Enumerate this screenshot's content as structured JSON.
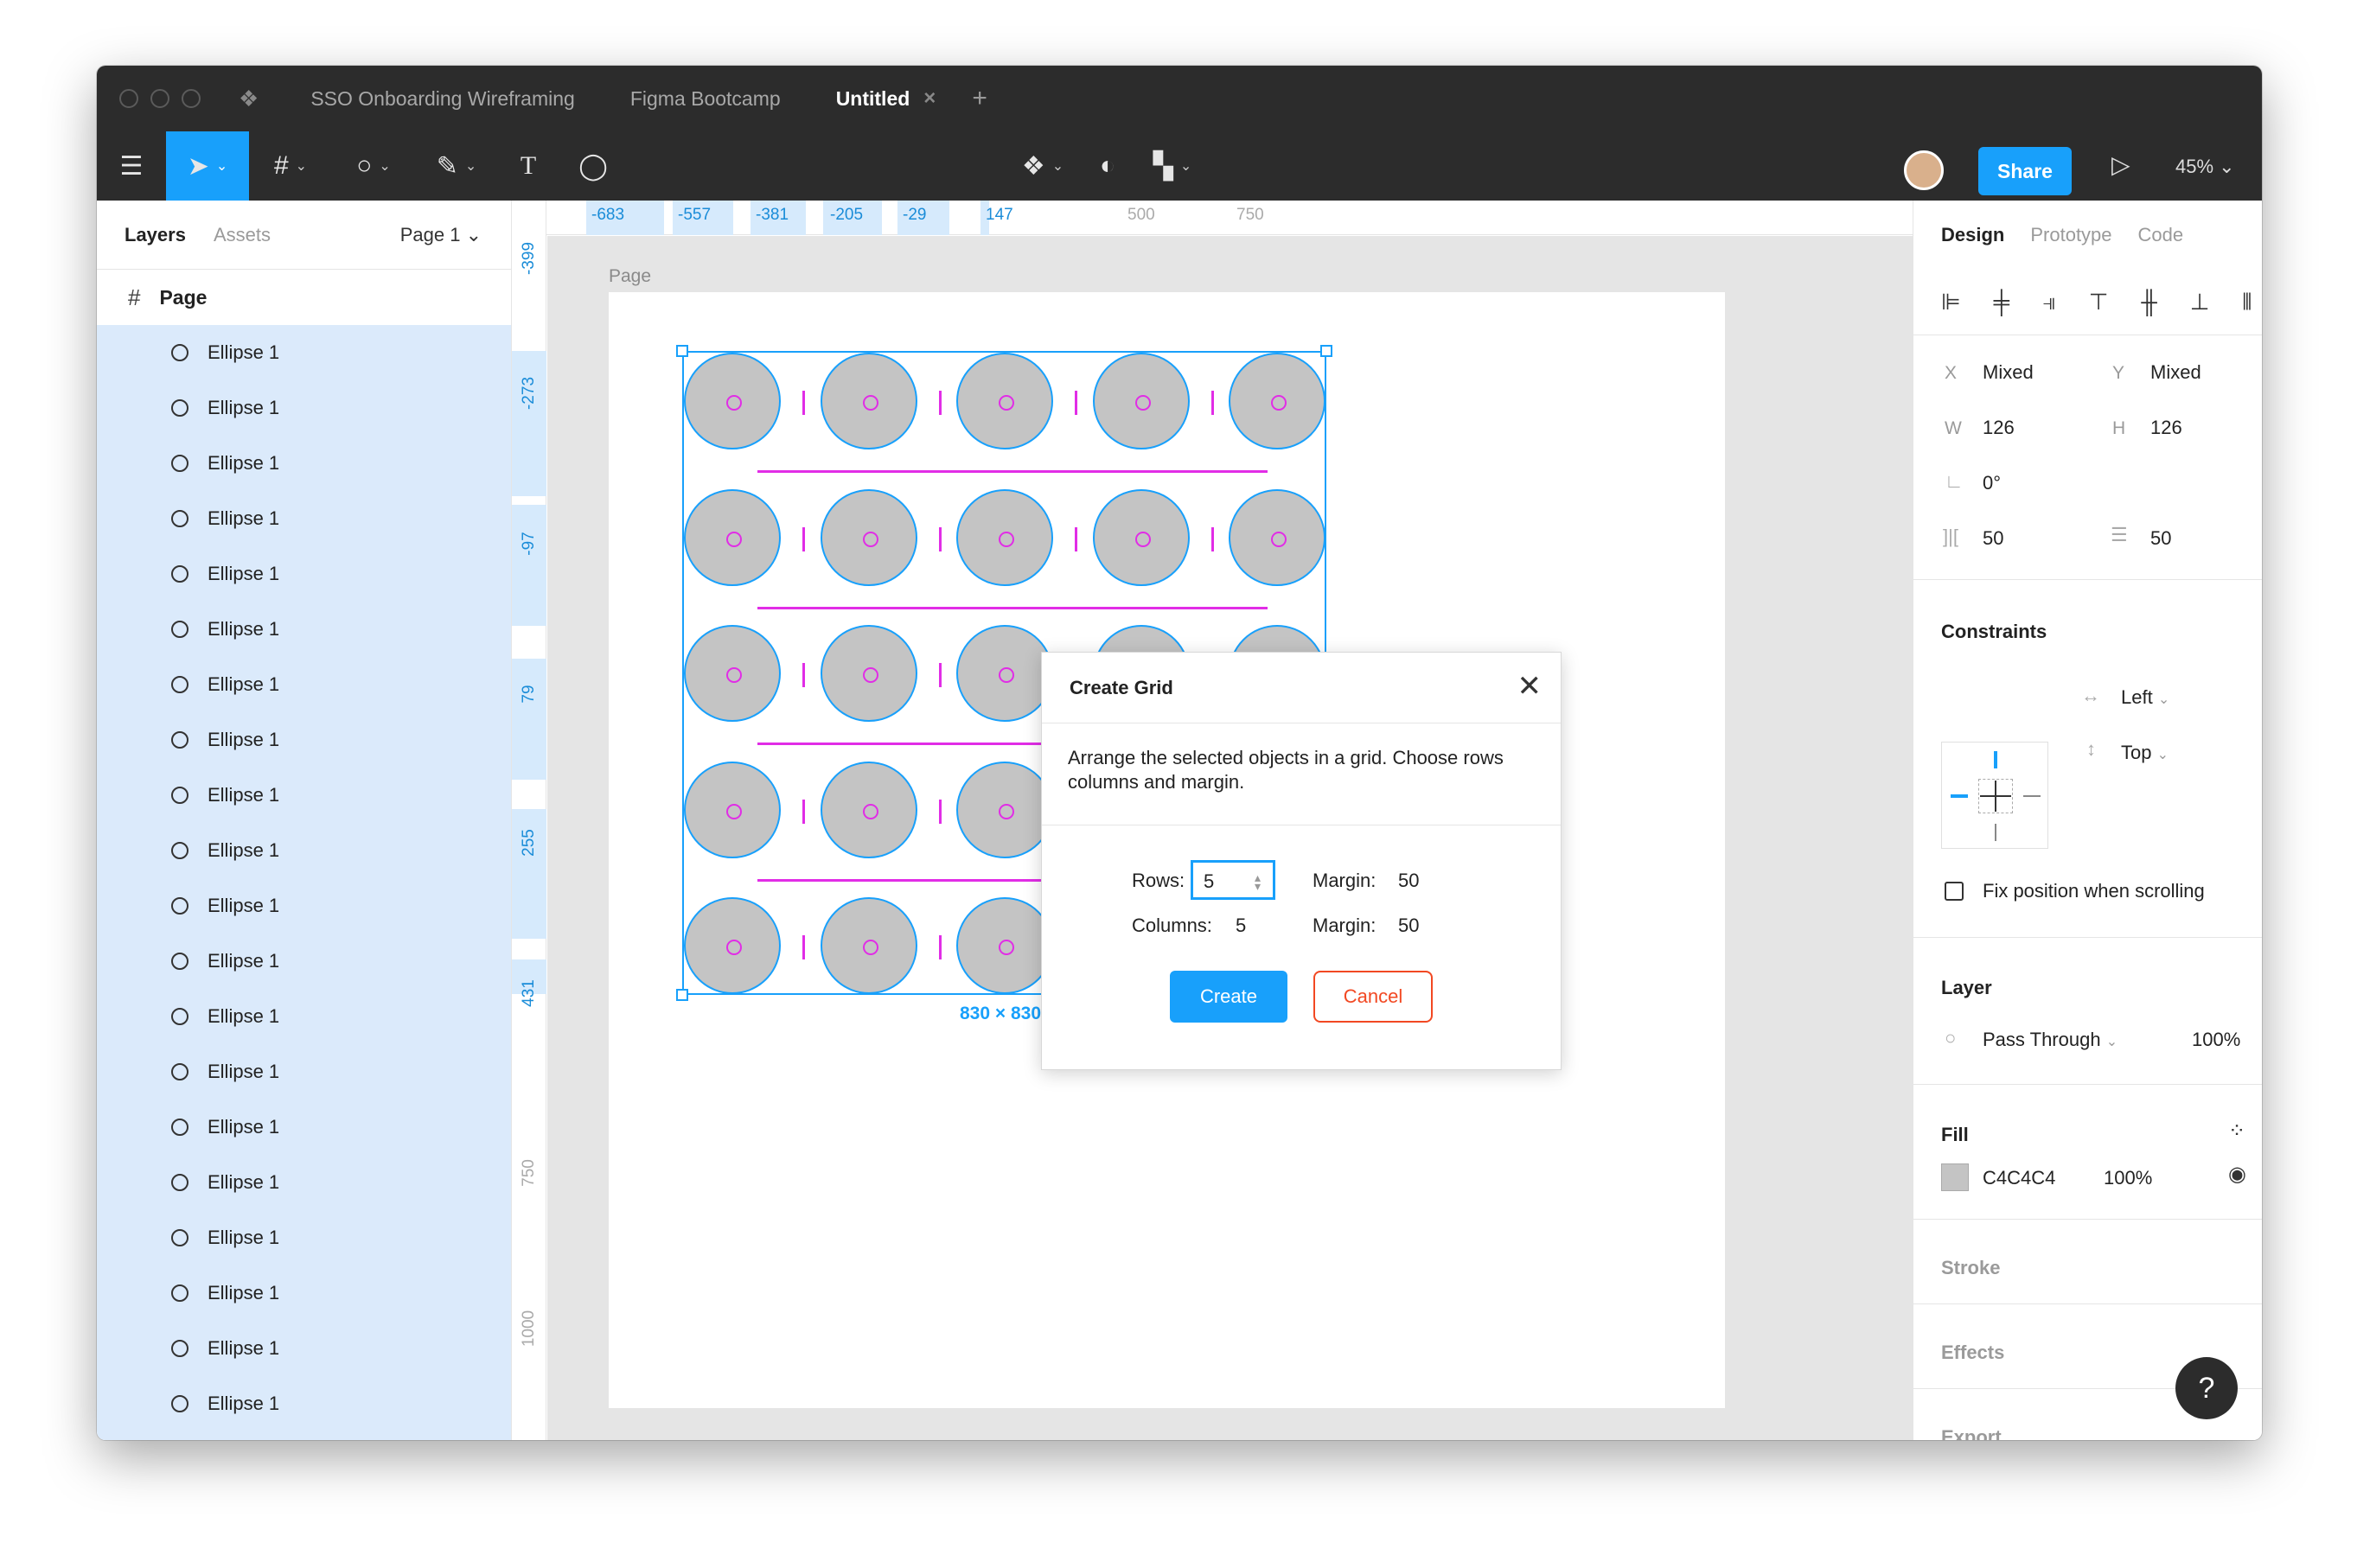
{
  "tabs": [
    {
      "label": "SSO Onboarding Wireframing"
    },
    {
      "label": "Figma Bootcamp"
    },
    {
      "label": "Untitled"
    }
  ],
  "toolbar": {
    "share_label": "Share",
    "zoom": "45%"
  },
  "left_panel": {
    "tab_layers": "Layers",
    "tab_assets": "Assets",
    "page_select": "Page 1",
    "page_name": "Page",
    "layers": [
      "Ellipse 1",
      "Ellipse 1",
      "Ellipse 1",
      "Ellipse 1",
      "Ellipse 1",
      "Ellipse 1",
      "Ellipse 1",
      "Ellipse 1",
      "Ellipse 1",
      "Ellipse 1",
      "Ellipse 1",
      "Ellipse 1",
      "Ellipse 1",
      "Ellipse 1",
      "Ellipse 1",
      "Ellipse 1",
      "Ellipse 1",
      "Ellipse 1",
      "Ellipse 1",
      "Ellipse 1"
    ]
  },
  "rulers": {
    "top": [
      "-683",
      "-557",
      "-381",
      "-205",
      "-29",
      "147",
      "500",
      "750"
    ],
    "left": [
      "-399",
      "-273",
      "-97",
      "79",
      "255",
      "431",
      "750",
      "1000"
    ]
  },
  "canvas": {
    "page_label": "Page",
    "selection_size": "830 × 830"
  },
  "dialog": {
    "title": "Create Grid",
    "description": "Arrange the selected objects in a grid. Choose rows columns and margin.",
    "rows_label": "Rows:",
    "rows_value": "5",
    "columns_label": "Columns:",
    "columns_value": "5",
    "margin_label_1": "Margin:",
    "margin_value_1": "50",
    "margin_label_2": "Margin:",
    "margin_value_2": "50",
    "create_label": "Create",
    "cancel_label": "Cancel"
  },
  "right_panel": {
    "tab_design": "Design",
    "tab_prototype": "Prototype",
    "tab_code": "Code",
    "x_label": "X",
    "x_value": "Mixed",
    "y_label": "Y",
    "y_value": "Mixed",
    "w_label": "W",
    "w_value": "126",
    "h_label": "H",
    "h_value": "126",
    "rotation": "0°",
    "spacing_h": "50",
    "spacing_v": "50",
    "constraints_title": "Constraints",
    "constraint_h": "Left",
    "constraint_v": "Top",
    "fix_position": "Fix position when scrolling",
    "layer_title": "Layer",
    "blend_mode": "Pass Through",
    "layer_opacity": "100%",
    "fill_title": "Fill",
    "fill_hex": "C4C4C4",
    "fill_opacity": "100%",
    "stroke_title": "Stroke",
    "effects_title": "Effects",
    "export_title": "Export"
  },
  "colors": {
    "accent": "#18a0fb",
    "margin_guide": "#e12de6",
    "fill": "#c4c4c4",
    "cancel": "#f24822"
  }
}
